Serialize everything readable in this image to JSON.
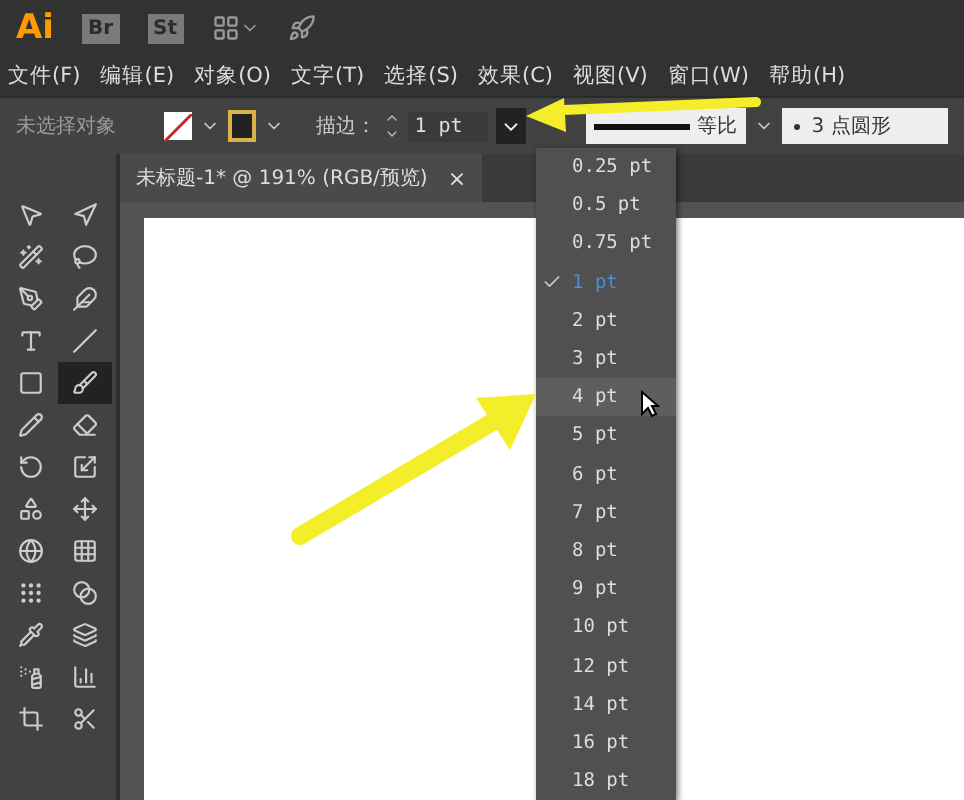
{
  "app_bar": {
    "logo": "Ai",
    "bridge": "Br",
    "stock": "St"
  },
  "menu": [
    "文件(F)",
    "编辑(E)",
    "对象(O)",
    "文字(T)",
    "选择(S)",
    "效果(C)",
    "视图(V)",
    "窗口(W)",
    "帮助(H)"
  ],
  "control_bar": {
    "selection": "未选择对象",
    "stroke_label": "描边：",
    "stroke_weight": "1 pt",
    "weight_menu_open": true,
    "profile": "等比",
    "brush": "3 点圆形"
  },
  "document_tab": {
    "title": "未标题-1* @ 191% (RGB/预览)",
    "close": "×"
  },
  "weight_options": [
    {
      "label": "0.25 pt",
      "selected": false,
      "highlighted": false
    },
    {
      "label": "0.5 pt",
      "selected": false,
      "highlighted": false
    },
    {
      "label": "0.75 pt",
      "selected": false,
      "highlighted": false
    },
    {
      "label": "1 pt",
      "selected": true,
      "highlighted": false
    },
    {
      "label": "2 pt",
      "selected": false,
      "highlighted": false
    },
    {
      "label": "3 pt",
      "selected": false,
      "highlighted": false
    },
    {
      "label": "4 pt",
      "selected": false,
      "highlighted": true
    },
    {
      "label": "5 pt",
      "selected": false,
      "highlighted": false
    },
    {
      "label": "6 pt",
      "selected": false,
      "highlighted": false
    },
    {
      "label": "7 pt",
      "selected": false,
      "highlighted": false
    },
    {
      "label": "8 pt",
      "selected": false,
      "highlighted": false
    },
    {
      "label": "9 pt",
      "selected": false,
      "highlighted": false
    },
    {
      "label": "10 pt",
      "selected": false,
      "highlighted": false
    },
    {
      "label": "12 pt",
      "selected": false,
      "highlighted": false
    },
    {
      "label": "14 pt",
      "selected": false,
      "highlighted": false
    },
    {
      "label": "16 pt",
      "selected": false,
      "highlighted": false
    },
    {
      "label": "18 pt",
      "selected": false,
      "highlighted": false
    }
  ]
}
